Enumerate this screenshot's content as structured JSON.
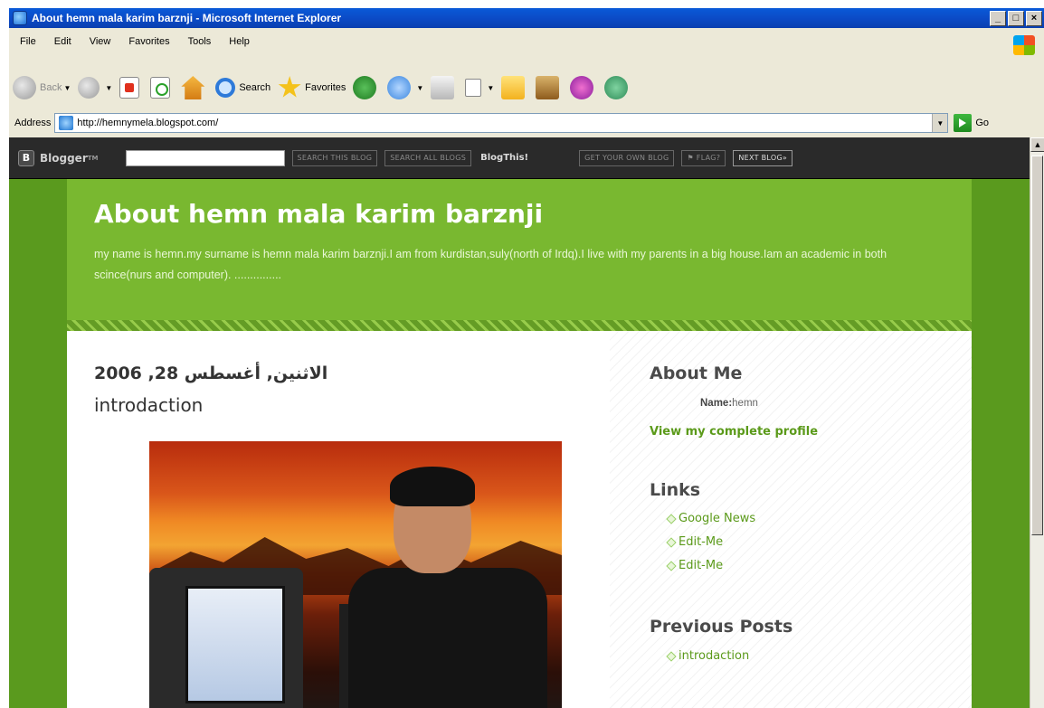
{
  "window": {
    "title": "About hemn mala karim barznji - Microsoft Internet Explorer",
    "controls": [
      "_",
      "□",
      "×"
    ]
  },
  "menu": [
    "File",
    "Edit",
    "View",
    "Favorites",
    "Tools",
    "Help"
  ],
  "toolbar": {
    "back": "Back",
    "search": "Search",
    "favorites": "Favorites"
  },
  "address": {
    "label": "Address",
    "url": "http://hemnymela.blogspot.com/",
    "go": "Go"
  },
  "blogger_bar": {
    "brand": "Blogger",
    "tm": "TM",
    "search_blog": "SEARCH THIS BLOG",
    "search_all": "SEARCH ALL BLOGS",
    "blogthis": "BlogThis!",
    "get_own": "GET YOUR OWN BLOG",
    "flag": "⚑ FLAG?",
    "next": "NEXT BLOG»"
  },
  "blog": {
    "title": "About hemn mala karim barznji",
    "description": "my name is hemn.my surname is hemn mala karim barznji.I am from kurdistan,suly(north of Irdq).I live with my parents in a big house.Iam an academic in both scince(nurs and computer). ..............."
  },
  "post": {
    "date": "الاثنين, أغسطس 28, 2006",
    "title": "introdaction"
  },
  "sidebar": {
    "about_heading": "About Me",
    "name_label": "Name:",
    "name_value": "hemn",
    "profile_link": "View my complete profile",
    "links_heading": "Links",
    "links": [
      "Google News",
      "Edit-Me",
      "Edit-Me"
    ],
    "previous_heading": "Previous Posts",
    "previous": [
      "introdaction"
    ]
  },
  "colors": {
    "accent_green": "#79b830",
    "outer_green": "#5a9a1e",
    "link_green": "#5b9a1a",
    "titlebar_blue": "#0b4bc7"
  }
}
